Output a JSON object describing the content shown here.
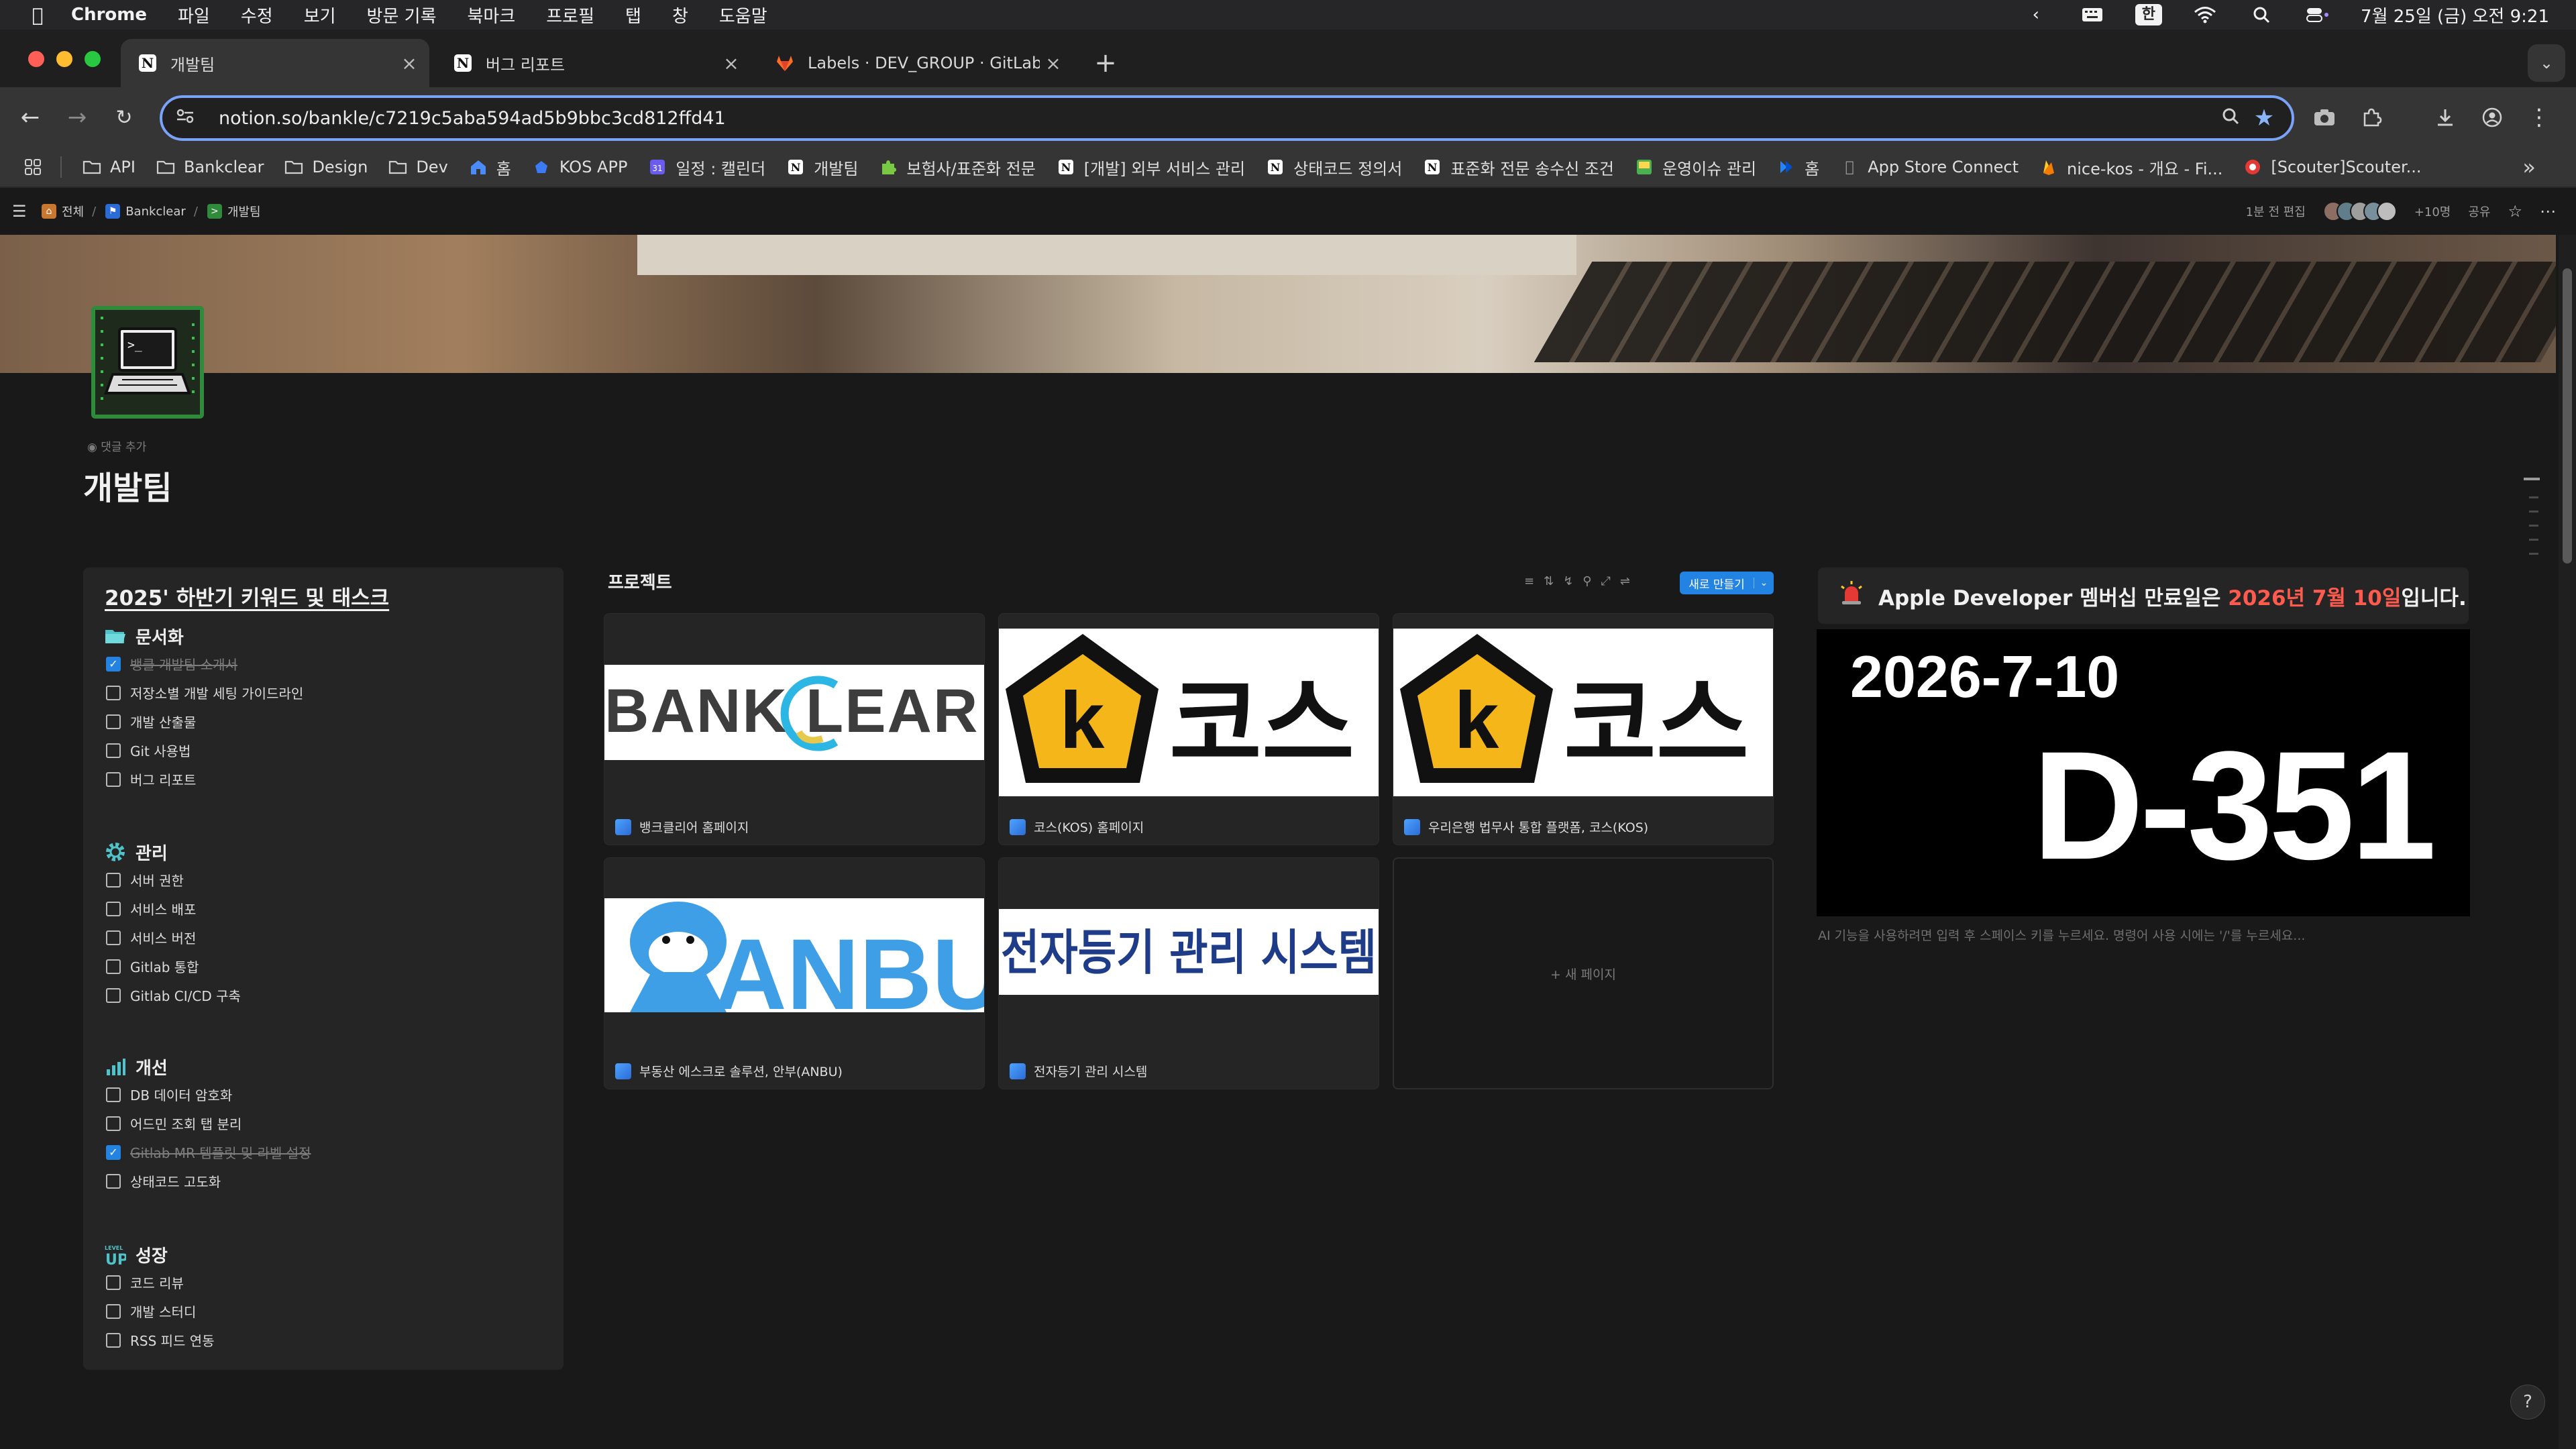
{
  "menubar": {
    "app": "Chrome",
    "items": [
      "파일",
      "수정",
      "보기",
      "방문 기록",
      "북마크",
      "프로필",
      "탭",
      "창",
      "도움말"
    ],
    "ime": "한",
    "clock": "7월 25일 (금) 오전 9:21"
  },
  "tabs": [
    {
      "title": "개발팀",
      "close": "×"
    },
    {
      "title": "버그 리포트",
      "close": "×"
    },
    {
      "title": "Labels · DEV_GROUP · GitLab",
      "close": "×"
    }
  ],
  "newtab": "+",
  "address": {
    "url": "notion.so/bankle/c7219c5aba594ad5b9bbc3cd812ffd41"
  },
  "bookmarks": [
    {
      "label": "API",
      "icon": "folder-icon"
    },
    {
      "label": "Bankclear",
      "icon": "folder-icon"
    },
    {
      "label": "Design",
      "icon": "folder-icon"
    },
    {
      "label": "Dev",
      "icon": "folder-icon"
    },
    {
      "label": "홈",
      "icon": "home-icon"
    },
    {
      "label": "KOS APP",
      "icon": "app-icon"
    },
    {
      "label": "일정 : 캘린더",
      "icon": "calendar-icon"
    },
    {
      "label": "개발팀",
      "icon": "notion-icon"
    },
    {
      "label": "보험사/표준화 전문",
      "icon": "puzzle-icon"
    },
    {
      "label": "[개발] 외부 서비스 관리",
      "icon": "notion-icon"
    },
    {
      "label": "상태코드 정의서",
      "icon": "notion-icon"
    },
    {
      "label": "표준화 전문 송수신 조건",
      "icon": "notion-icon"
    },
    {
      "label": "운영이슈 관리",
      "icon": "image-icon"
    },
    {
      "label": "홈",
      "icon": "jira-icon"
    },
    {
      "label": "App Store Connect",
      "icon": "apple-icon"
    },
    {
      "label": "nice-kos - 개요 - Fi...",
      "icon": "firebase-icon"
    },
    {
      "label": "[Scouter]Scouter...",
      "icon": "scouter-icon"
    }
  ],
  "notion": {
    "breadcrumb": [
      "전체",
      "Bankclear",
      "개발팀"
    ],
    "edited": "1분 전 편집",
    "more_people": "+10명",
    "share": "공유",
    "add_comment": "댓글 추가",
    "page_title": "개발팀"
  },
  "callout": {
    "title": "2025' 하반기 키워드 및 태스크",
    "sections": [
      {
        "title": "문서화",
        "icon": "folder-icon",
        "items": [
          {
            "text": "뱅클 개발팀 소개서",
            "done": true
          },
          {
            "text": "저장소별 개발 세팅 가이드라인",
            "done": false
          },
          {
            "text": "개발 산출물",
            "done": false
          },
          {
            "text": "Git 사용법",
            "done": false
          },
          {
            "text": "버그 리포트",
            "done": false
          }
        ]
      },
      {
        "title": "관리",
        "icon": "gear-icon",
        "items": [
          {
            "text": "서버 권한",
            "done": false
          },
          {
            "text": "서비스 배포",
            "done": false
          },
          {
            "text": "서비스 버전",
            "done": false
          },
          {
            "text": "Gitlab 통합",
            "done": false
          },
          {
            "text": "Gitlab CI/CD 구축",
            "done": false
          }
        ]
      },
      {
        "title": "개선",
        "icon": "chart-icon",
        "items": [
          {
            "text": "DB 데이터 암호화",
            "done": false
          },
          {
            "text": "어드민 조회 탭 분리",
            "done": false
          },
          {
            "text": "Gitlab MR 템플릿 및 라벨 설정",
            "done": true
          },
          {
            "text": "상태코드 고도화",
            "done": false
          }
        ]
      },
      {
        "title": "성장",
        "icon": "level-up-icon",
        "items": [
          {
            "text": "코드 리뷰",
            "done": false
          },
          {
            "text": "개발 스터디",
            "done": false
          },
          {
            "text": "RSS 피드 연동",
            "done": false
          }
        ]
      }
    ]
  },
  "projects": {
    "title": "프로젝트",
    "new_button": "새로 만들기",
    "new_page": "+ 새 페이지",
    "cards": [
      {
        "title": "뱅크클리어 홈페이지",
        "logo": "BANKCLEAR"
      },
      {
        "title": "코스(KOS) 홈페이지",
        "logo": "코스"
      },
      {
        "title": "우리은행 법무사 통합 플랫폼, 코스(KOS)",
        "logo": "코스"
      },
      {
        "title": "부동산 에스크로 솔루션, 안부(ANBU)",
        "logo": "ANBU"
      },
      {
        "title": "전자등기 관리 시스템",
        "logo": "전자등기 관리 시스템"
      }
    ]
  },
  "dday": {
    "callout_prefix": "Apple Developer 멤버십 만료일은 ",
    "callout_highlight": "2026년 7월 10일",
    "callout_suffix": "입니다.",
    "date": "2026-7-10",
    "countdown": "D-351",
    "ai_hint": "AI 기능을 사용하려면 입력 후 스페이스 키를 누르세요. 명령어 사용 시에는 '/'를 누르세요..."
  },
  "colors": {
    "accent": "#2383e2",
    "highlight": "#ff5a4e",
    "bg": "#191919",
    "callout_bg": "#252525"
  }
}
